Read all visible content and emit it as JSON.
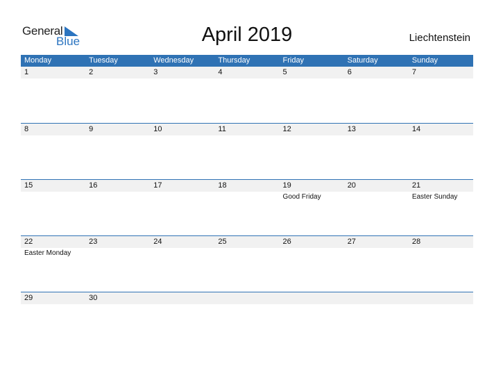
{
  "logo": {
    "general": "General",
    "blue": "Blue"
  },
  "title": "April 2019",
  "country": "Liechtenstein",
  "weekdays": [
    "Monday",
    "Tuesday",
    "Wednesday",
    "Thursday",
    "Friday",
    "Saturday",
    "Sunday"
  ],
  "weeks": [
    [
      {
        "day": "1"
      },
      {
        "day": "2"
      },
      {
        "day": "3"
      },
      {
        "day": "4"
      },
      {
        "day": "5"
      },
      {
        "day": "6"
      },
      {
        "day": "7"
      }
    ],
    [
      {
        "day": "8"
      },
      {
        "day": "9"
      },
      {
        "day": "10"
      },
      {
        "day": "11"
      },
      {
        "day": "12"
      },
      {
        "day": "13"
      },
      {
        "day": "14"
      }
    ],
    [
      {
        "day": "15"
      },
      {
        "day": "16"
      },
      {
        "day": "17"
      },
      {
        "day": "18"
      },
      {
        "day": "19",
        "event": "Good Friday"
      },
      {
        "day": "20"
      },
      {
        "day": "21",
        "event": "Easter Sunday"
      }
    ],
    [
      {
        "day": "22",
        "event": "Easter Monday"
      },
      {
        "day": "23"
      },
      {
        "day": "24"
      },
      {
        "day": "25"
      },
      {
        "day": "26"
      },
      {
        "day": "27"
      },
      {
        "day": "28"
      }
    ],
    [
      {
        "day": "29"
      },
      {
        "day": "30"
      },
      {
        "day": ""
      },
      {
        "day": ""
      },
      {
        "day": ""
      },
      {
        "day": ""
      },
      {
        "day": ""
      }
    ]
  ]
}
